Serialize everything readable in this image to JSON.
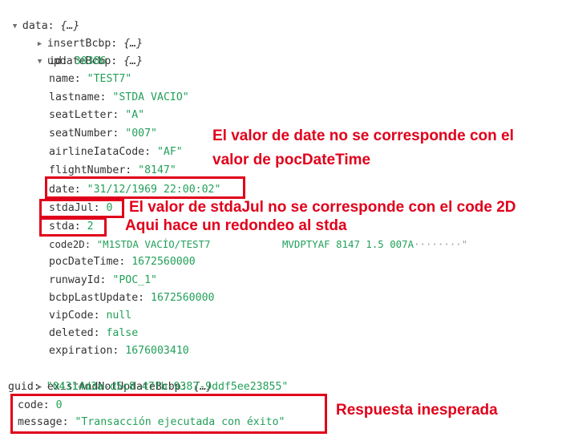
{
  "tree": {
    "data_key": "data",
    "data_preview": "{…}",
    "insert_key": "insertBcbp",
    "insert_preview": "{…}",
    "update_key": "updateBcbp",
    "update_preview": "{…}",
    "fields": [
      {
        "key": "id",
        "value": "30386"
      },
      {
        "key": "name",
        "value": "\"TEST7\""
      },
      {
        "key": "lastname",
        "value": "\"STDA VACIO\""
      },
      {
        "key": "seatLetter",
        "value": "\"A\""
      },
      {
        "key": "seatNumber",
        "value": "\"007\""
      },
      {
        "key": "airlineIataCode",
        "value": "\"AF\""
      },
      {
        "key": "flightNumber",
        "value": "\"8147\""
      },
      {
        "key": "date",
        "value": "\"31/12/1969 22:00:02\""
      },
      {
        "key": "stdaJul",
        "value": "0"
      },
      {
        "key": "stda",
        "value": "2"
      },
      {
        "key": "code2D",
        "value": "\"M1STDA VACÍO/TEST7            MVDPTYAF 8147 1.5 007A",
        "tail": "········\""
      },
      {
        "key": "pocDateTime",
        "value": "1672560000"
      },
      {
        "key": "runwayId",
        "value": "\"POC_1\""
      },
      {
        "key": "bcbpLastUpdate",
        "value": "1672560000"
      },
      {
        "key": "vipCode",
        "value": "null"
      },
      {
        "key": "deleted",
        "value": "false"
      },
      {
        "key": "expiration",
        "value": "1676003410"
      }
    ],
    "exist_key": "existAndNotUpdateBcbp",
    "exist_preview": "{…}",
    "guid_key": "guid",
    "guid_value": "\"04314d3a-d5c8-47fb-9387-9ddf5ee23855\"",
    "code_key": "code",
    "code_value": "0",
    "message_key": "message",
    "message_value": "\"Transacción ejecutada con éxito\""
  },
  "annotations": {
    "date_note_line1": "El valor de date no se corresponde con el",
    "date_note_line2": "valor de pocDateTime",
    "stdajul_note": "El valor de stdaJul no se corresponde con el code 2D",
    "stda_note": "Aqui hace un redondeo al stda",
    "response_note": "Respuesta inesperada"
  },
  "colors": {
    "annotation_red": "#e0001b",
    "value_green": "#23a05a",
    "key_text": "#333333"
  },
  "icons": {
    "expanded": "triangle-down-icon",
    "collapsed": "triangle-right-icon"
  }
}
